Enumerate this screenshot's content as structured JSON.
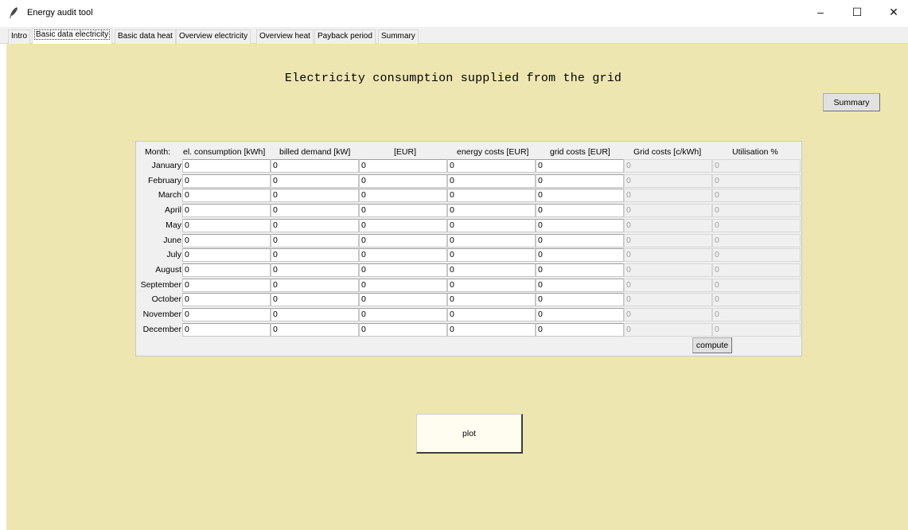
{
  "window": {
    "title": "Energy audit tool",
    "icon": "feather-icon",
    "controls": {
      "minimize": "–",
      "maximize": "☐",
      "close": "✕"
    }
  },
  "tabs": [
    {
      "label": "Intro"
    },
    {
      "label": "Basic data electricity",
      "active": true
    },
    {
      "label": "Basic data heat"
    },
    {
      "label": "Overview electricity"
    },
    {
      "label": "Overview heat"
    },
    {
      "label": "Payback period"
    },
    {
      "label": "Summary"
    }
  ],
  "page": {
    "heading": "Electricity consumption supplied from the grid",
    "summary_button": "Summary",
    "compute_button": "compute",
    "plot_button": "plot"
  },
  "table": {
    "columns": [
      "Month:",
      "el. consumption [kWh]",
      "billed demand [kW]",
      "[EUR]",
      "energy costs [EUR]",
      "grid costs [EUR]",
      "Grid costs [c/kWh]",
      "Utilisation %"
    ],
    "readonly_columns": [
      5,
      6
    ],
    "rows": [
      {
        "month": "January",
        "values": [
          "0",
          "0",
          "0",
          "0",
          "0",
          "0",
          "0"
        ]
      },
      {
        "month": "February",
        "values": [
          "0",
          "0",
          "0",
          "0",
          "0",
          "0",
          "0"
        ]
      },
      {
        "month": "March",
        "values": [
          "0",
          "0",
          "0",
          "0",
          "0",
          "0",
          "0"
        ]
      },
      {
        "month": "April",
        "values": [
          "0",
          "0",
          "0",
          "0",
          "0",
          "0",
          "0"
        ]
      },
      {
        "month": "May",
        "values": [
          "0",
          "0",
          "0",
          "0",
          "0",
          "0",
          "0"
        ]
      },
      {
        "month": "June",
        "values": [
          "0",
          "0",
          "0",
          "0",
          "0",
          "0",
          "0"
        ]
      },
      {
        "month": "July",
        "values": [
          "0",
          "0",
          "0",
          "0",
          "0",
          "0",
          "0"
        ]
      },
      {
        "month": "August",
        "values": [
          "0",
          "0",
          "0",
          "0",
          "0",
          "0",
          "0"
        ]
      },
      {
        "month": "September",
        "values": [
          "0",
          "0",
          "0",
          "0",
          "0",
          "0",
          "0"
        ]
      },
      {
        "month": "October",
        "values": [
          "0",
          "0",
          "0",
          "0",
          "0",
          "0",
          "0"
        ]
      },
      {
        "month": "November",
        "values": [
          "0",
          "0",
          "0",
          "0",
          "0",
          "0",
          "0"
        ]
      },
      {
        "month": "December",
        "values": [
          "0",
          "0",
          "0",
          "0",
          "0",
          "0",
          "0"
        ]
      }
    ]
  },
  "colors": {
    "panel_background": "#eee6b1",
    "plot_button_background": "#fefdf0"
  }
}
